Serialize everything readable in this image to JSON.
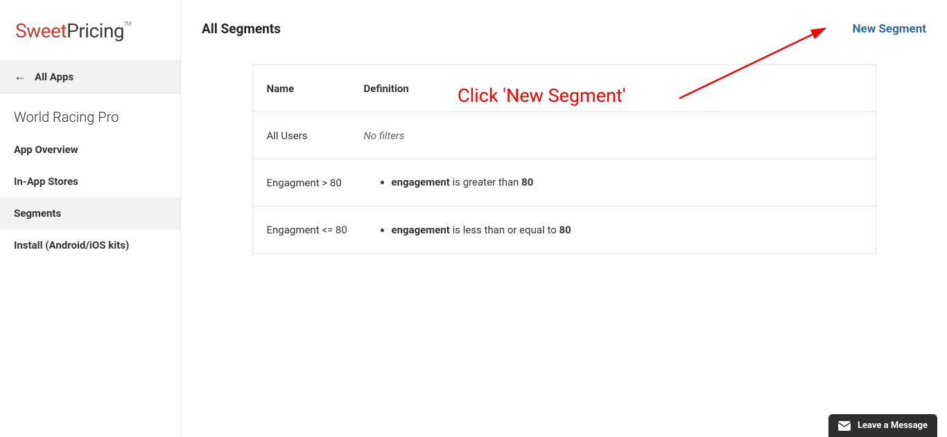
{
  "brand": {
    "part1": "Sweet",
    "part2": "Pricing",
    "tm": "TM"
  },
  "sidebar": {
    "all_apps": "All Apps",
    "app_name": "World Racing Pro",
    "items": [
      {
        "label": "App Overview"
      },
      {
        "label": "In-App Stores"
      },
      {
        "label": "Segments"
      },
      {
        "label": "Install (Android/iOS kits)"
      }
    ]
  },
  "page": {
    "title": "All Segments",
    "new_segment": "New Segment"
  },
  "table": {
    "head_name": "Name",
    "head_def": "Definition",
    "row1_name": "All Users",
    "row1_def": "No filters",
    "row2_name": "Engagment > 80",
    "row2_metric": "engagement",
    "row2_text": " is greater than ",
    "row2_value": "80",
    "row3_name": "Engagment <= 80",
    "row3_metric": "engagement",
    "row3_text": " is less than or equal to ",
    "row3_value": "80"
  },
  "annotation": "Click 'New Segment'",
  "chat": "Leave a Message"
}
